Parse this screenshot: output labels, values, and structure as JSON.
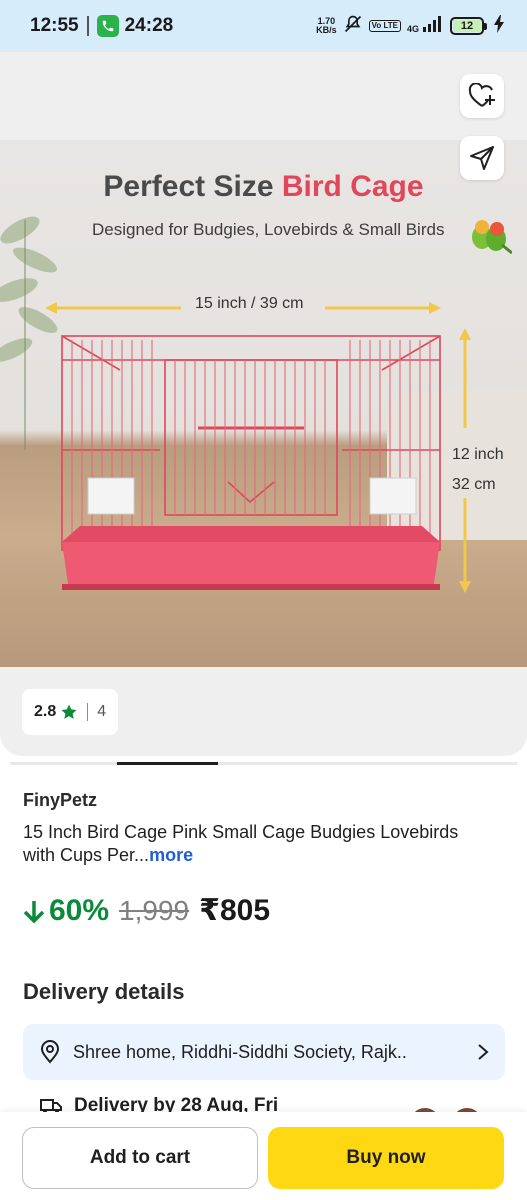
{
  "status_bar": {
    "time": "12:55",
    "call_time": "24:28",
    "net_speed_value": "1.70",
    "net_speed_unit": "KB/s",
    "volte": "Vo LTE",
    "network": "4G",
    "battery": "12"
  },
  "product_image": {
    "title_part1": "Perfect Size",
    "title_part2": "Bird Cage",
    "subtitle": "Designed for Budgies, Lovebirds & Small Birds",
    "width_label": "15 inch / 39 cm",
    "height_inch": "12 inch",
    "height_cm": "32 cm"
  },
  "rating": {
    "value": "2.8",
    "count": "4"
  },
  "product": {
    "brand": "FinyPetz",
    "title": "15 Inch Bird Cage Pink Small Cage Budgies Lovebirds with Cups Per...",
    "more_label": "more",
    "discount": "60%",
    "mrp": "1,999",
    "price": "₹805"
  },
  "delivery": {
    "section_title": "Delivery details",
    "address": "Shree home, Riddhi-Siddhi Society, Rajk..",
    "delivery_text": "Delivery by 28 Aug, Fri"
  },
  "actions": {
    "add_to_cart": "Add to cart",
    "buy_now": "Buy now"
  },
  "colors": {
    "accent_yellow": "#ffd814",
    "discount_green": "#0b8a3a",
    "link_blue": "#1f5fd6",
    "cage_pink": "#e0475b",
    "address_bg": "#eaf3fe"
  }
}
